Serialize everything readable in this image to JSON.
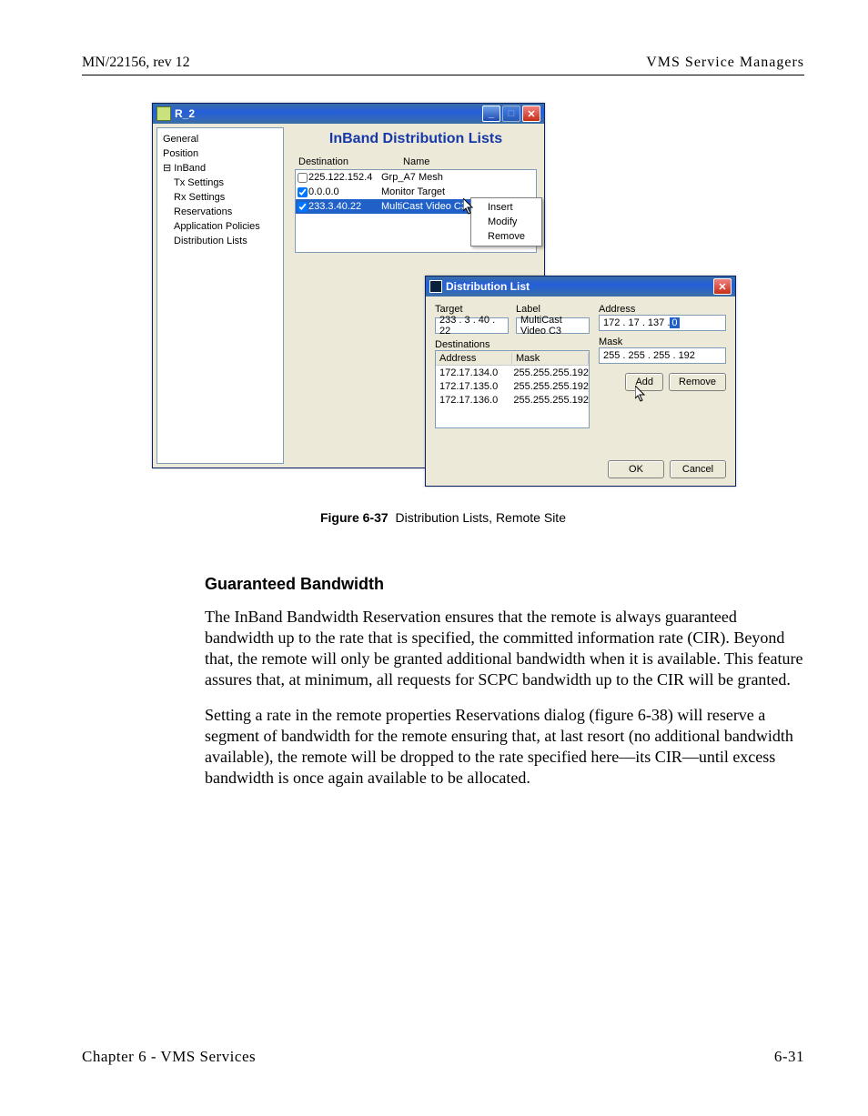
{
  "header": {
    "left": "MN/22156, rev 12",
    "right": "VMS Service Managers"
  },
  "footer": {
    "left": "Chapter 6 - VMS Services",
    "right": "6-31"
  },
  "figure": {
    "number": "Figure 6-37",
    "title": "Distribution Lists, Remote Site"
  },
  "subsection_heading": "Guaranteed Bandwidth",
  "paragraphs": {
    "p1": "The InBand Bandwidth Reservation ensures that the remote is always guaranteed bandwidth up to the rate that is specified, the committed information rate (CIR). Beyond that, the remote will only be granted additional bandwidth when it is available. This feature assures that, at minimum, all requests for SCPC bandwidth up to the CIR will be granted.",
    "p2": "Setting a rate in the remote properties Reservations dialog (figure 6-38) will reserve a segment of bandwidth for the remote ensuring that, at last resort (no additional bandwidth available), the remote will be dropped to the rate specified here—its CIR—until excess bandwidth is once again available to be allocated."
  },
  "window_r2": {
    "title": "R_2",
    "panel_title": "InBand Distribution Lists",
    "tree": {
      "general": "General",
      "position": "Position",
      "inband_root": "InBand",
      "tx": "Tx Settings",
      "rx": "Rx Settings",
      "res": "Reservations",
      "app": "Application Policies",
      "dist": "Distribution Lists"
    },
    "grid": {
      "col_destination": "Destination",
      "col_name": "Name",
      "rows": [
        {
          "checked": false,
          "destination": "225.122.152.4",
          "name": "Grp_A7 Mesh"
        },
        {
          "checked": true,
          "destination": "0.0.0.0",
          "name": "Monitor Target"
        },
        {
          "checked": true,
          "destination": "233.3.40.22",
          "name": "MultiCast Video C3",
          "selected": true
        }
      ]
    },
    "context_menu": {
      "insert": "Insert",
      "modify": "Modify",
      "remove": "Remove"
    }
  },
  "dialog": {
    "title": "Distribution List",
    "target_label": "Target",
    "label_label": "Label",
    "target_value": "233 .  3  . 40 . 22",
    "label_value": "MultiCast Video C3",
    "destinations_heading": "Destinations",
    "col_address": "Address",
    "col_mask": "Mask",
    "rows": [
      {
        "address": "172.17.134.0",
        "mask": "255.255.255.192"
      },
      {
        "address": "172.17.135.0",
        "mask": "255.255.255.192"
      },
      {
        "address": "172.17.136.0",
        "mask": "255.255.255.192"
      }
    ],
    "address_label": "Address",
    "address_value_prefix": "172 . 17 . 137 . ",
    "address_value_sel": "0",
    "mask_label": "Mask",
    "mask_value": "255 . 255 . 255 . 192",
    "add_btn": "Add",
    "remove_btn": "Remove",
    "ok_btn": "OK",
    "cancel_btn": "Cancel"
  }
}
